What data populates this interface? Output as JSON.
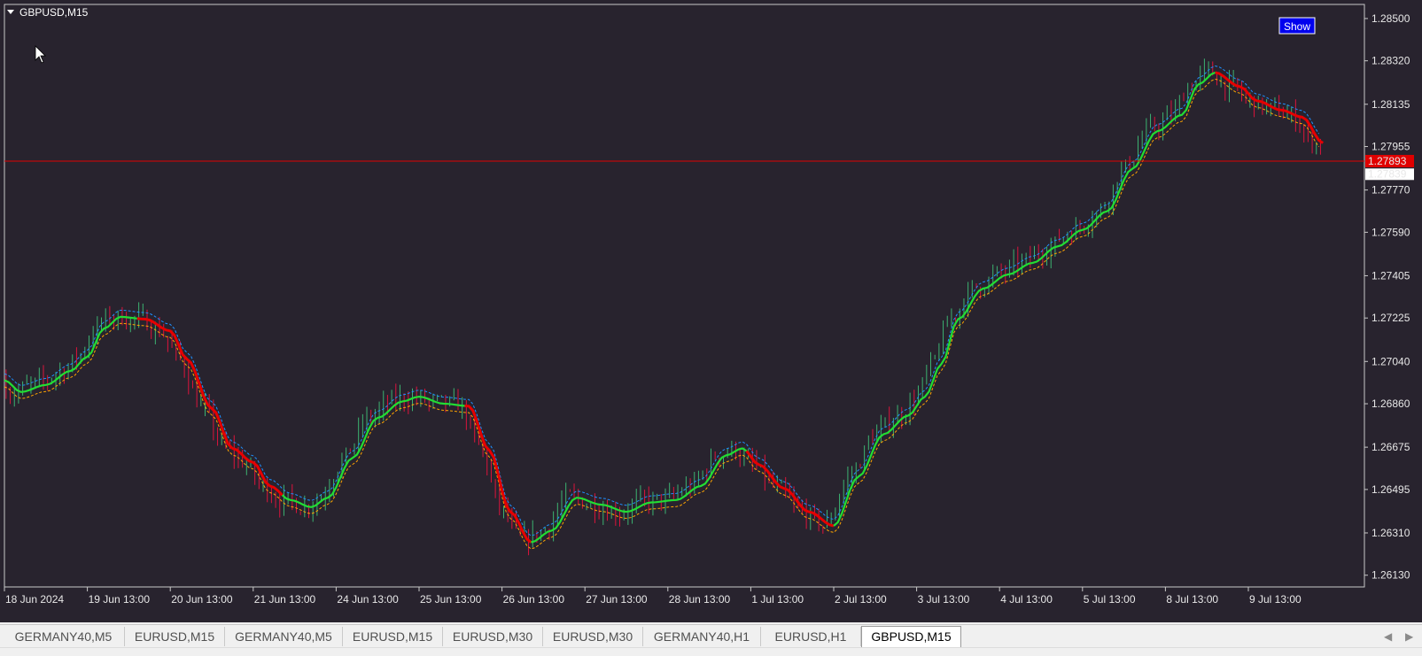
{
  "chart": {
    "symbol_title": "GBPUSD,M15",
    "show_button_label": "Show",
    "colors": {
      "background": "#28232e",
      "frame": "#c8c8c8",
      "bull_candle": "#3cb371",
      "bear_candle": "#dc143c",
      "ma_up": "#22dd33",
      "ma_down": "#e60000",
      "band_upper": "#1e90ff",
      "band_lower": "#ffa500",
      "price_line": "#e00000",
      "text": "#e8e8e8"
    },
    "price_axis": {
      "ticks": [
        "1.28500",
        "1.28320",
        "1.28135",
        "1.27955",
        "1.27770",
        "1.27590",
        "1.27405",
        "1.27225",
        "1.27040",
        "1.26860",
        "1.26675",
        "1.26495",
        "1.26310",
        "1.26130"
      ],
      "ylim": [
        1.2608,
        1.2856
      ],
      "bid_label": "1.27893",
      "bid_value": 1.27893,
      "ask_label": "1.27839",
      "ask_value": 1.27839
    },
    "time_axis": {
      "labels": [
        "18 Jun 2024",
        "19 Jun 13:00",
        "20 Jun 13:00",
        "21 Jun 13:00",
        "24 Jun 13:00",
        "25 Jun 13:00",
        "26 Jun 13:00",
        "27 Jun 13:00",
        "28 Jun 13:00",
        "1 Jul 13:00",
        "2 Jul 13:00",
        "3 Jul 13:00",
        "4 Jul 13:00",
        "5 Jul 13:00",
        "8 Jul 13:00",
        "9 Jul 13:00"
      ]
    },
    "ma_curve": [
      [
        0,
        1.2696
      ],
      [
        0.2,
        1.2691
      ],
      [
        0.5,
        1.2694
      ],
      [
        0.8,
        1.27
      ],
      [
        1.0,
        1.2706
      ],
      [
        1.2,
        1.2718
      ],
      [
        1.4,
        1.2723
      ],
      [
        1.7,
        1.2722
      ],
      [
        2.0,
        1.2717
      ],
      [
        2.2,
        1.2705
      ],
      [
        2.5,
        1.2684
      ],
      [
        2.75,
        1.2667
      ],
      [
        3.0,
        1.2661
      ],
      [
        3.2,
        1.2651
      ],
      [
        3.45,
        1.2645
      ],
      [
        3.7,
        1.2642
      ],
      [
        3.9,
        1.2646
      ],
      [
        4.2,
        1.2663
      ],
      [
        4.5,
        1.268
      ],
      [
        4.8,
        1.2687
      ],
      [
        5.0,
        1.2689
      ],
      [
        5.3,
        1.2686
      ],
      [
        5.6,
        1.2685
      ],
      [
        5.85,
        1.2666
      ],
      [
        6.1,
        1.264
      ],
      [
        6.35,
        1.2627
      ],
      [
        6.6,
        1.2632
      ],
      [
        6.9,
        1.2646
      ],
      [
        7.2,
        1.2643
      ],
      [
        7.5,
        1.264
      ],
      [
        7.8,
        1.2644
      ],
      [
        8.1,
        1.2645
      ],
      [
        8.4,
        1.2651
      ],
      [
        8.7,
        1.2664
      ],
      [
        8.9,
        1.2667
      ],
      [
        9.1,
        1.266
      ],
      [
        9.4,
        1.265
      ],
      [
        9.7,
        1.264
      ],
      [
        10.0,
        1.2634
      ],
      [
        10.3,
        1.2655
      ],
      [
        10.6,
        1.2673
      ],
      [
        10.9,
        1.2681
      ],
      [
        11.1,
        1.2689
      ],
      [
        11.3,
        1.2703
      ],
      [
        11.5,
        1.2722
      ],
      [
        11.8,
        1.2735
      ],
      [
        12.1,
        1.2741
      ],
      [
        12.4,
        1.2746
      ],
      [
        12.7,
        1.2753
      ],
      [
        13.0,
        1.276
      ],
      [
        13.3,
        1.2768
      ],
      [
        13.6,
        1.2786
      ],
      [
        13.9,
        1.2802
      ],
      [
        14.2,
        1.2809
      ],
      [
        14.4,
        1.2822
      ],
      [
        14.6,
        1.2827
      ],
      [
        14.9,
        1.2821
      ],
      [
        15.1,
        1.2815
      ],
      [
        15.4,
        1.2811
      ],
      [
        15.65,
        1.2808
      ],
      [
        15.9,
        1.2797
      ]
    ],
    "ma_down_segments": [
      [
        1.6,
        3.3
      ],
      [
        5.5,
        6.3
      ],
      [
        8.9,
        10.0
      ],
      [
        14.6,
        15.9
      ]
    ]
  },
  "tabs": [
    {
      "label": "GERMANY40,M5",
      "active": false
    },
    {
      "label": "EURUSD,M15",
      "active": false
    },
    {
      "label": "GERMANY40,M5",
      "active": false
    },
    {
      "label": "EURUSD,M15",
      "active": false
    },
    {
      "label": "EURUSD,M30",
      "active": false
    },
    {
      "label": "EURUSD,M30",
      "active": false
    },
    {
      "label": "GERMANY40,H1",
      "active": false
    },
    {
      "label": "EURUSD,H1",
      "active": false
    },
    {
      "label": "GBPUSD,M15",
      "active": true
    }
  ],
  "tab_scroll": {
    "left_icon": "scroll-left-icon",
    "right_icon": "scroll-right-icon"
  }
}
